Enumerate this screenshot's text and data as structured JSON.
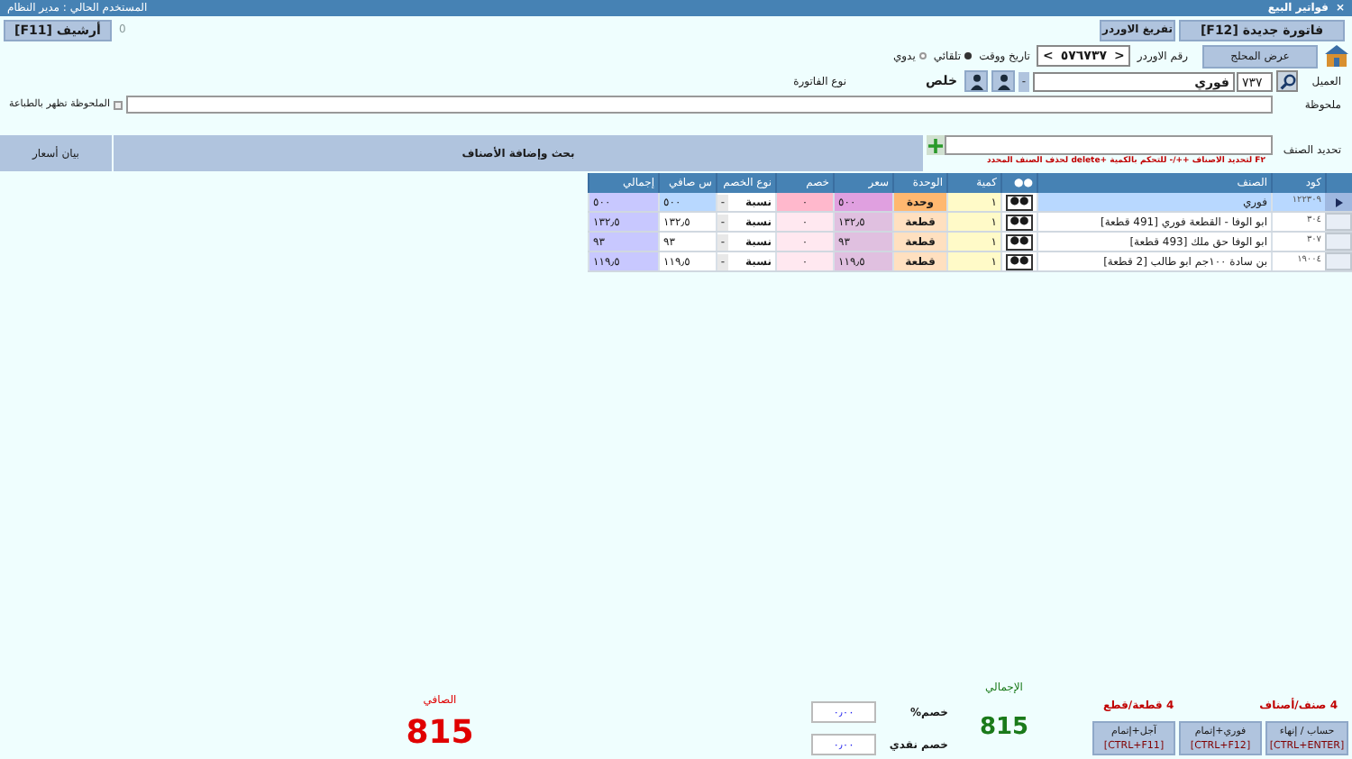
{
  "window": {
    "title": "فواتير البيع",
    "close": "×",
    "user": "المستخدم الحالي : مدير النظام"
  },
  "toolbar": {
    "new_invoice": "فاتورة جديدة [F12]",
    "clear_order": "تفريغ الاوردر",
    "archive": "أرشيف [F11]",
    "archive_count": "0",
    "show_store": "عرض المحلج"
  },
  "order": {
    "label": "رقم الاوردر",
    "prev": "<",
    "number": "٥٧٦٧٣٧",
    "next": ">",
    "datetime_label": "تاريخ ووقت",
    "datetime_modes": [
      {
        "label": "تلقائي",
        "selected": true
      },
      {
        "label": "يدوي",
        "selected": false
      }
    ]
  },
  "customer": {
    "label": "العميل",
    "code": "٧٣٧",
    "name": "فوري",
    "dropdown": "-",
    "status": "خلص",
    "invoice_type_label": "نوع الفاتورة"
  },
  "note": {
    "label": "ملحوظة",
    "print_label": "الملحوظة تظهر بالطباعة",
    "print_checked": false
  },
  "item_select": {
    "label": "تحديد الصنف",
    "hint": "F٢ لتحديد الاصناف ++/- للتحكم بالكمية +delete لحذف الصنف المحدد"
  },
  "panels": {
    "search_add": "بحث وإضافة الأصناف",
    "price_list": "بيان أسعار"
  },
  "table": {
    "columns": [
      "كود",
      "الصنف",
      "●●",
      "كمية",
      "الوحدة",
      "سعر",
      "خصم",
      "نوع الخصم",
      "س صافي",
      "إجمالي"
    ],
    "rows": [
      {
        "selected": true,
        "code": "١٢٢٣٠٩",
        "name": "فوري",
        "dots": "●●",
        "qty": "١",
        "unit": "وحدة",
        "price": "٥٠٠",
        "discount": "٠",
        "discount_type": "نسبة",
        "discount_menu": "-",
        "net": "٥٠٠",
        "total": "٥٠٠"
      },
      {
        "selected": false,
        "code": "٣٠٤",
        "name": "ابو الوفا - القطعة فوري [491 قطعة]",
        "dots": "●●",
        "qty": "١",
        "unit": "قطعة",
        "price": "١٣٢٫٥",
        "discount": "٠",
        "discount_type": "نسبة",
        "discount_menu": "-",
        "net": "١٣٢٫٥",
        "total": "١٣٢٫٥"
      },
      {
        "selected": false,
        "code": "٣٠٧",
        "name": "ابو الوفا حق ملك [493 قطعة]",
        "dots": "●●",
        "qty": "١",
        "unit": "قطعة",
        "price": "٩٣",
        "discount": "٠",
        "discount_type": "نسبة",
        "discount_menu": "-",
        "net": "٩٣",
        "total": "٩٣"
      },
      {
        "selected": false,
        "code": "١٩٠٠٤",
        "name": "بن سادة ١٠٠جم ابو طالب [2 قطعة]",
        "dots": "●●",
        "qty": "١",
        "unit": "قطعة",
        "price": "١١٩٫٥",
        "discount": "٠",
        "discount_type": "نسبة",
        "discount_menu": "-",
        "net": "١١٩٫٥",
        "total": "١١٩٫٥"
      }
    ]
  },
  "footer": {
    "items_count": "4 صنف/أصناف",
    "pieces_count": "4 قطعة/قطع",
    "total_label": "الإجمالي",
    "total": "815",
    "discount_pct_label": "خصم%",
    "discount_pct": "٠٫٠٠",
    "discount_cash_label": "خصم نقدي",
    "discount_cash": "٠٫٠٠",
    "net_label": "الصافي",
    "net": "815",
    "buttons": [
      {
        "label": "حساب / إنهاء",
        "shortcut": "[CTRL+ENTER]"
      },
      {
        "label": "فوري+إتمام",
        "shortcut": "[CTRL+F12]"
      },
      {
        "label": "آجل+إتمام",
        "shortcut": "[CTRL+F11]"
      }
    ]
  }
}
